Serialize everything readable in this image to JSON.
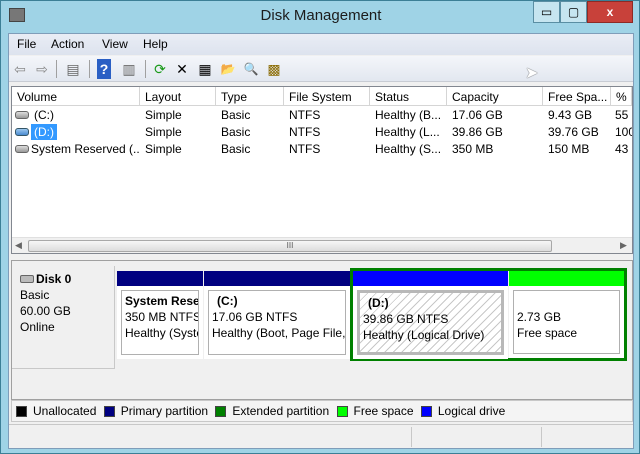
{
  "window": {
    "title": "Disk Management",
    "minimize": "▭",
    "maximize": "▢",
    "close": "x"
  },
  "menu": [
    "File",
    "Action",
    "View",
    "Help"
  ],
  "toolbar": [
    {
      "icon": "back-arrow-icon",
      "glyph": "⇦"
    },
    {
      "icon": "forward-arrow-icon",
      "glyph": "⇨"
    },
    {
      "icon": "show-hide-console-tree-icon",
      "glyph": "▤"
    },
    {
      "icon": "help-icon",
      "glyph": "?"
    },
    {
      "icon": "show-hide-action-pane-icon",
      "glyph": "▥"
    },
    {
      "icon": "refresh-icon",
      "glyph": "⟳"
    },
    {
      "icon": "delete-icon",
      "glyph": "✕"
    },
    {
      "icon": "properties-icon",
      "glyph": "▦"
    },
    {
      "icon": "open-folder-icon",
      "glyph": "📂"
    },
    {
      "icon": "explore-icon",
      "glyph": "🔍"
    },
    {
      "icon": "disk-settings-icon",
      "glyph": "▩"
    }
  ],
  "table": {
    "columns": [
      "Volume",
      "Layout",
      "Type",
      "File System",
      "Status",
      "Capacity",
      "Free Spa...",
      "% F"
    ],
    "rows": [
      [
        "(C:)",
        "Simple",
        "Basic",
        "NTFS",
        "Healthy (B...",
        "17.06 GB",
        "9.43 GB",
        "55"
      ],
      [
        "(D:)",
        "Simple",
        "Basic",
        "NTFS",
        "Healthy (L...",
        "39.86 GB",
        "39.76 GB",
        "100"
      ],
      [
        "System Reserved (...",
        "Simple",
        "Basic",
        "NTFS",
        "Healthy (S...",
        "350 MB",
        "150 MB",
        "43"
      ]
    ],
    "selected_row": 1,
    "scroll_thumb": "III"
  },
  "disk": {
    "name": "Disk 0",
    "type": "Basic",
    "size": "60.00 GB",
    "state": "Online",
    "partitions": [
      {
        "name": "System Rese",
        "size": "350 MB NTFS",
        "status": "Healthy (Syste",
        "kind": "primary"
      },
      {
        "name": "(C:)",
        "size": "17.06 GB NTFS",
        "status": "Healthy (Boot, Page File,",
        "kind": "primary"
      },
      {
        "name": "(D:)",
        "size": "39.86 GB NTFS",
        "status": "Healthy (Logical Drive)",
        "kind": "logical"
      },
      {
        "name": "",
        "size": "2.73 GB",
        "status": "Free space",
        "kind": "free"
      }
    ]
  },
  "legend": [
    {
      "label": "Unallocated",
      "color": "#000000"
    },
    {
      "label": "Primary partition",
      "color": "#000080"
    },
    {
      "label": "Extended partition",
      "color": "#008000"
    },
    {
      "label": "Free space",
      "color": "#00ff00"
    },
    {
      "label": "Logical drive",
      "color": "#0000ff"
    }
  ]
}
